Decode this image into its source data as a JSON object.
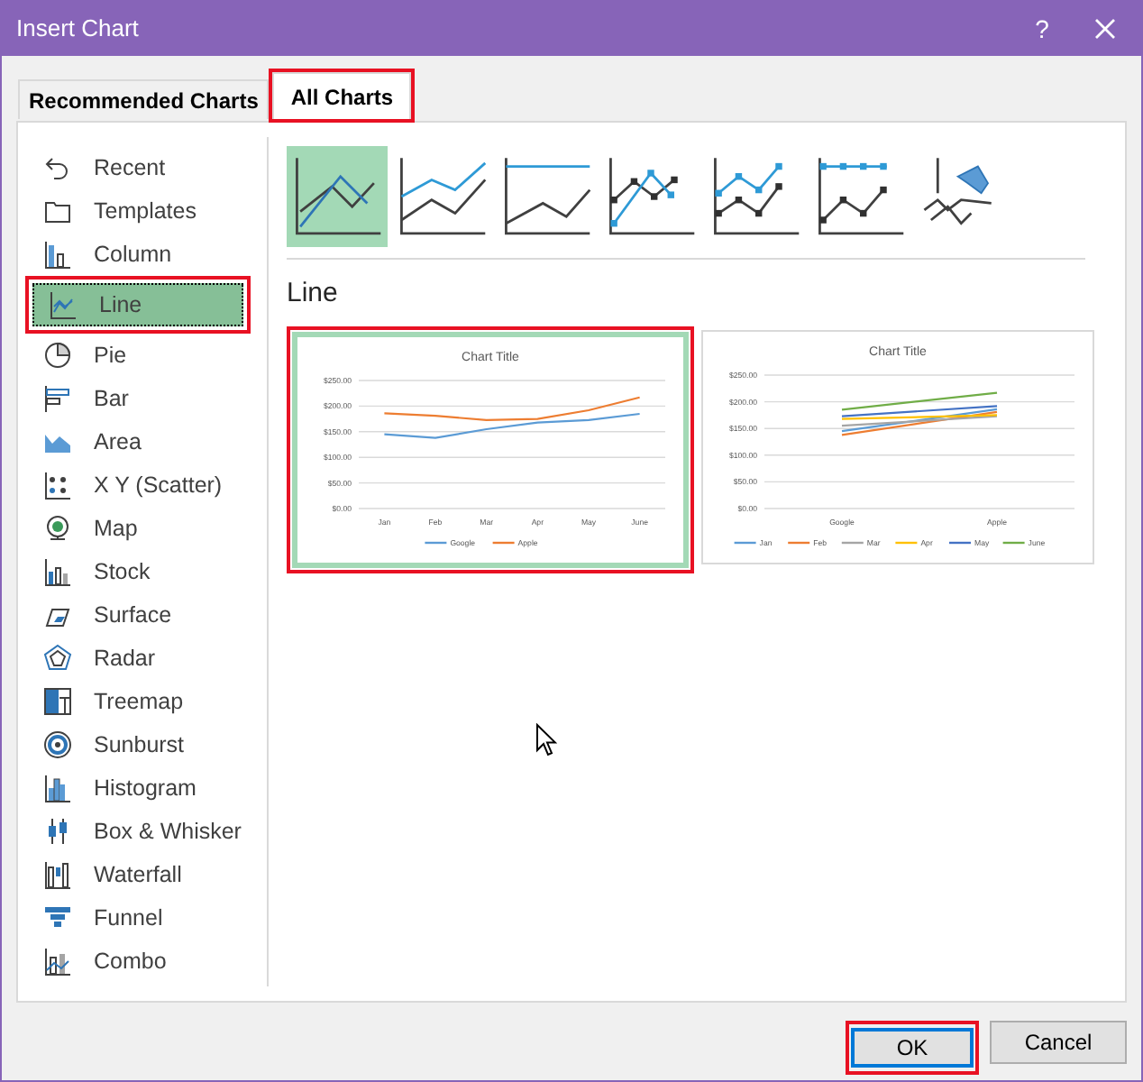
{
  "window": {
    "title": "Insert Chart",
    "help_button": "?"
  },
  "tabs": [
    {
      "label": "Recommended Charts",
      "selected": false,
      "highlighted": false
    },
    {
      "label": "All Charts",
      "selected": true,
      "highlighted": true
    }
  ],
  "sidebar": {
    "items": [
      {
        "label": "Recent",
        "selected": false,
        "highlighted": false
      },
      {
        "label": "Templates",
        "selected": false,
        "highlighted": false
      },
      {
        "label": "Column",
        "selected": false,
        "highlighted": false
      },
      {
        "label": "Line",
        "selected": true,
        "highlighted": true
      },
      {
        "label": "Pie",
        "selected": false,
        "highlighted": false
      },
      {
        "label": "Bar",
        "selected": false,
        "highlighted": false
      },
      {
        "label": "Area",
        "selected": false,
        "highlighted": false
      },
      {
        "label": "X Y (Scatter)",
        "selected": false,
        "highlighted": false
      },
      {
        "label": "Map",
        "selected": false,
        "highlighted": false
      },
      {
        "label": "Stock",
        "selected": false,
        "highlighted": false
      },
      {
        "label": "Surface",
        "selected": false,
        "highlighted": false
      },
      {
        "label": "Radar",
        "selected": false,
        "highlighted": false
      },
      {
        "label": "Treemap",
        "selected": false,
        "highlighted": false
      },
      {
        "label": "Sunburst",
        "selected": false,
        "highlighted": false
      },
      {
        "label": "Histogram",
        "selected": false,
        "highlighted": false
      },
      {
        "label": "Box & Whisker",
        "selected": false,
        "highlighted": false
      },
      {
        "label": "Waterfall",
        "selected": false,
        "highlighted": false
      },
      {
        "label": "Funnel",
        "selected": false,
        "highlighted": false
      },
      {
        "label": "Combo",
        "selected": false,
        "highlighted": false
      }
    ]
  },
  "subtypes": [
    {
      "selected": true
    },
    {
      "selected": false
    },
    {
      "selected": false
    },
    {
      "selected": false
    },
    {
      "selected": false
    },
    {
      "selected": false
    },
    {
      "selected": false
    }
  ],
  "heading": "Line",
  "previews": [
    {
      "selected": true,
      "highlighted": true,
      "chart_data": {
        "type": "line",
        "title": "Chart Title",
        "grid": true,
        "legend": "bottom",
        "categories": [
          "Jan",
          "Feb",
          "Mar",
          "Apr",
          "May",
          "June"
        ],
        "series": [
          {
            "name": "Google",
            "color": "#5b9bd5",
            "values": [
              145,
              138,
              155,
              168,
              173,
              185
            ]
          },
          {
            "name": "Apple",
            "color": "#ed7d31",
            "values": [
              186,
              181,
              173,
              175,
              192,
              217
            ]
          }
        ],
        "ylim": [
          0,
          250
        ],
        "yticks": [
          {
            "value": 0,
            "label": "$0.00"
          },
          {
            "value": 50,
            "label": "$50.00"
          },
          {
            "value": 100,
            "label": "$100.00"
          },
          {
            "value": 150,
            "label": "$150.00"
          },
          {
            "value": 200,
            "label": "$200.00"
          },
          {
            "value": 250,
            "label": "$250.00"
          }
        ]
      }
    },
    {
      "selected": false,
      "highlighted": false,
      "chart_data": {
        "type": "line",
        "title": "Chart Title",
        "grid": true,
        "legend": "bottom",
        "categories": [
          "Google",
          "Apple"
        ],
        "series": [
          {
            "name": "Jan",
            "color": "#5b9bd5",
            "values": [
              145,
              186
            ]
          },
          {
            "name": "Feb",
            "color": "#ed7d31",
            "values": [
              138,
              181
            ]
          },
          {
            "name": "Mar",
            "color": "#a5a5a5",
            "values": [
              155,
              173
            ]
          },
          {
            "name": "Apr",
            "color": "#ffc000",
            "values": [
              168,
              175
            ]
          },
          {
            "name": "May",
            "color": "#4472c4",
            "values": [
              173,
              192
            ]
          },
          {
            "name": "June",
            "color": "#70ad47",
            "values": [
              185,
              217
            ]
          }
        ],
        "ylim": [
          0,
          250
        ],
        "yticks": [
          {
            "value": 0,
            "label": "$0.00"
          },
          {
            "value": 50,
            "label": "$50.00"
          },
          {
            "value": 100,
            "label": "$100.00"
          },
          {
            "value": 150,
            "label": "$150.00"
          },
          {
            "value": 200,
            "label": "$200.00"
          },
          {
            "value": 250,
            "label": "$250.00"
          }
        ]
      }
    }
  ],
  "buttons": [
    {
      "label": "OK",
      "kind": "default",
      "highlighted": true
    },
    {
      "label": "Cancel",
      "kind": "normal",
      "highlighted": false
    }
  ]
}
